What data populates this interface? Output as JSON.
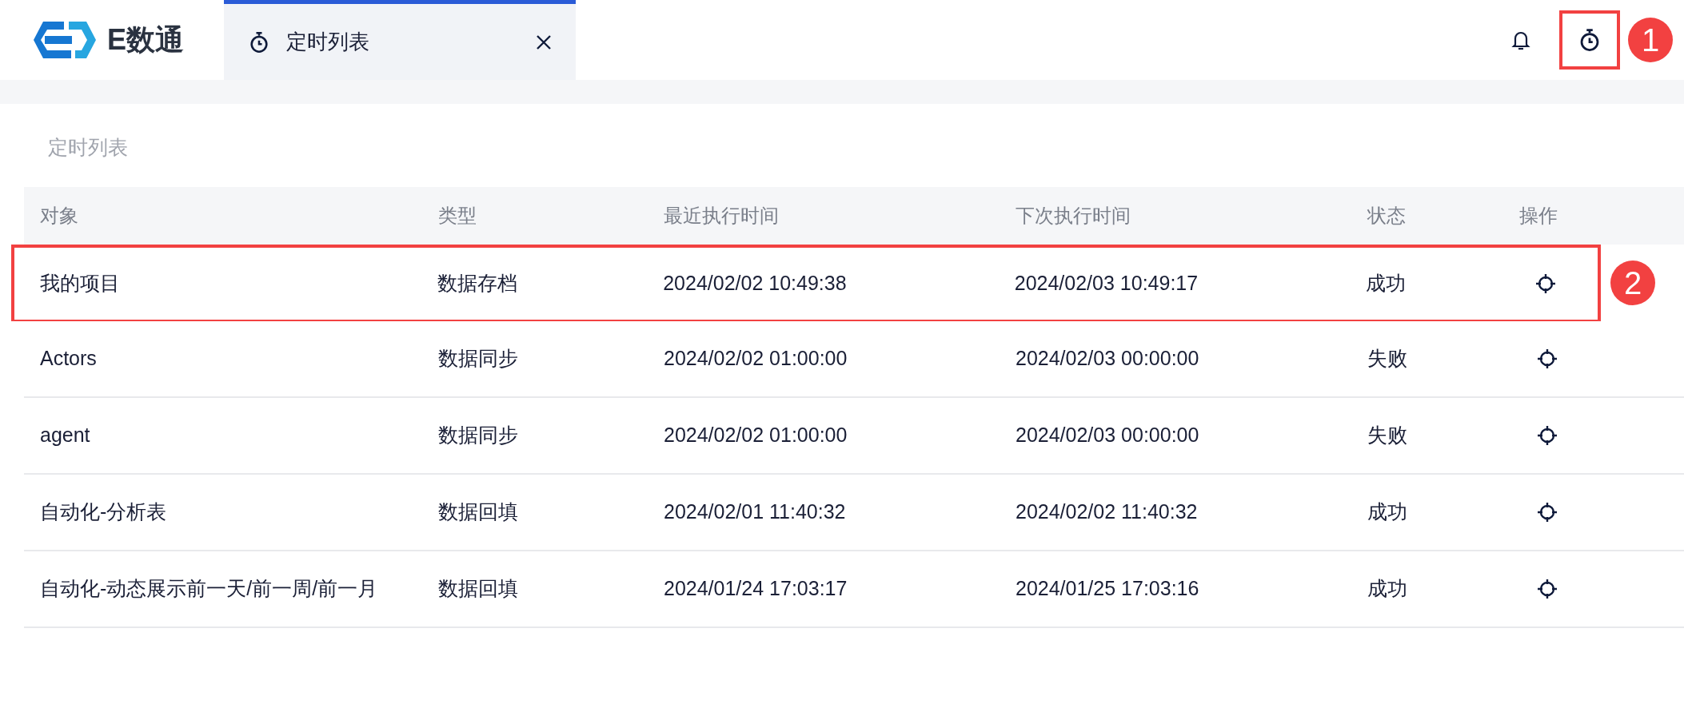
{
  "logo": {
    "text": "E数通"
  },
  "tabs": [
    {
      "label": "定时列表",
      "selected": true
    }
  ],
  "header_icons": [
    {
      "kind": "bell",
      "outlined": false
    },
    {
      "kind": "timer",
      "outlined": true,
      "callout": "1"
    }
  ],
  "page_title": "定时列表",
  "table": {
    "columns": [
      "对象",
      "类型",
      "最近执行时间",
      "下次执行时间",
      "状态",
      "操作"
    ],
    "rows": [
      {
        "cells": [
          "我的项目",
          "数据存档",
          "2024/02/02 10:49:38",
          "2024/02/03 10:49:17",
          "成功"
        ],
        "outlined": true,
        "callout": "2"
      },
      {
        "cells": [
          "Actors",
          "数据同步",
          "2024/02/02 01:00:00",
          "2024/02/03 00:00:00",
          "失败"
        ],
        "outlined": false
      },
      {
        "cells": [
          "agent",
          "数据同步",
          "2024/02/02 01:00:00",
          "2024/02/03 00:00:00",
          "失败"
        ],
        "outlined": false
      },
      {
        "cells": [
          "自动化-分析表",
          "数据回填",
          "2024/02/01 11:40:32",
          "2024/02/02 11:40:32",
          "成功"
        ],
        "outlined": false
      },
      {
        "cells": [
          "自动化-动态展示前一天/前一周/前一月",
          "数据回填",
          "2024/01/24 17:03:17",
          "2024/01/25 17:03:16",
          "成功"
        ],
        "outlined": false
      }
    ]
  }
}
